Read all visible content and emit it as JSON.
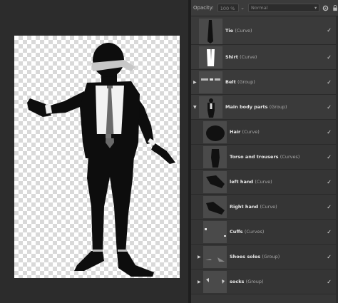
{
  "toolbar": {
    "opacity_label": "Opacity:",
    "opacity_value": "100 %",
    "blend_mode": "Normal"
  },
  "layers": [
    {
      "name": "Tie",
      "type": "(Curve)",
      "visible": "✓"
    },
    {
      "name": "Shirt",
      "type": "(Curve)",
      "visible": "✓"
    },
    {
      "name": "Belt",
      "type": "(Group)",
      "visible": "✓",
      "expander": "▶"
    },
    {
      "name": "Main body parts",
      "type": "(Group)",
      "visible": "✓",
      "expander": "▼"
    },
    {
      "name": "Hair",
      "type": "(Curve)",
      "visible": "✓"
    },
    {
      "name": "Torso and trousers",
      "type": "(Curves)",
      "visible": "✓"
    },
    {
      "name": "left hand",
      "type": "(Curve)",
      "visible": "✓"
    },
    {
      "name": "Right hand",
      "type": "(Curve)",
      "visible": "✓"
    },
    {
      "name": "Cuffs",
      "type": "(Curves)",
      "visible": "✓"
    },
    {
      "name": "Shoes soles",
      "type": "(Group)",
      "visible": "✓",
      "expander": "▶"
    },
    {
      "name": "socks",
      "type": "(Group)",
      "visible": "✓",
      "expander": "▶"
    }
  ],
  "colors": {
    "panel_bg": "#373737",
    "canvas_bg": "#2c2c2c",
    "figure": "#0d0d0d",
    "blindfold": "#c8c8c8"
  }
}
